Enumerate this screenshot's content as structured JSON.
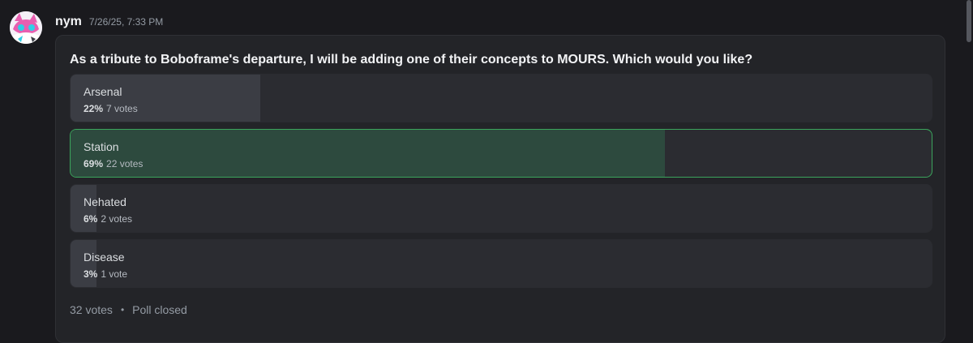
{
  "message": {
    "author": "nym",
    "timestamp": "7/26/25, 7:33 PM",
    "avatar_icon": "avatar-icon"
  },
  "poll": {
    "question": "As a tribute to Boboframe's departure, I will be adding one of their concepts to MOURS. Which would you like?",
    "answers": [
      {
        "label": "Arsenal",
        "percent": "22%",
        "votes": "7 votes",
        "share": 0.22,
        "winner": false
      },
      {
        "label": "Station",
        "percent": "69%",
        "votes": "22 votes",
        "share": 0.69,
        "winner": true
      },
      {
        "label": "Nehated",
        "percent": "6%",
        "votes": "2 votes",
        "share": 0.03,
        "winner": false
      },
      {
        "label": "Disease",
        "percent": "3%",
        "votes": "1 vote",
        "share": 0.03,
        "winner": false
      }
    ],
    "total_votes": "32 votes",
    "separator": "•",
    "status": "Poll closed"
  },
  "colors": {
    "background": "#1a1a1e",
    "poll_bg": "#232428",
    "winner_border": "#3ba55c",
    "winner_fill": "#2d4a3e",
    "fill": "#3b3d44"
  }
}
